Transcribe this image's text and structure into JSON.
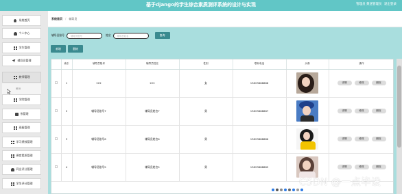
{
  "header": {
    "title": "基于django的学生综合素质测评系统的设计与实现",
    "user_text": "管理员 黄迷管理员",
    "logout": "退出登录",
    "bg_color": "#61c6c6"
  },
  "sidebar": {
    "items": [
      {
        "label": "系统首页",
        "icon": "house-icon"
      },
      {
        "label": "个人中心",
        "icon": "person-icon"
      },
      {
        "label": "学生管理",
        "icon": "grid-icon"
      },
      {
        "label": "辅导员管理",
        "icon": "plane-icon"
      },
      {
        "label": "教师管理",
        "icon": "grid-icon"
      },
      {
        "label": "学院管理",
        "icon": "grid-icon"
      },
      {
        "label": "系管理",
        "icon": "box-icon"
      },
      {
        "label": "班级管理",
        "icon": "grid-icon"
      },
      {
        "label": "学习绩效管理",
        "icon": "grid-icon"
      },
      {
        "label": "德育素质管理",
        "icon": "grid-icon"
      },
      {
        "label": "同业评分管理",
        "icon": "person-icon"
      },
      {
        "label": "学生评分管理",
        "icon": "grid-icon"
      }
    ],
    "submenu": "教师"
  },
  "breadcrumb": {
    "home": "系统首页",
    "current": "辅导员"
  },
  "search": {
    "field1_label": "辅导员账号",
    "field1_placeholder": "辅导员账号",
    "field2_label": "姓名",
    "field2_placeholder": "辅导员姓名",
    "button": "查询"
  },
  "actions": {
    "add": "新增",
    "delete": "删除"
  },
  "table": {
    "headers": [
      "",
      "索引",
      "辅导员账号",
      "辅导员姓名",
      "性别",
      "联系电话",
      "头像",
      "操作"
    ],
    "rows": [
      {
        "index": "1",
        "account": "222",
        "name": "222",
        "gender": "女",
        "phone": "13823888888"
      },
      {
        "index": "2",
        "account": "辅导员账号7",
        "name": "辅导员姓名7",
        "gender": "男",
        "phone": "13823888887"
      },
      {
        "index": "3",
        "account": "辅导员账号6",
        "name": "辅导员姓名6",
        "gender": "男",
        "phone": "13823888886"
      },
      {
        "index": "4",
        "account": "辅导员账号5",
        "name": "辅导员姓名5",
        "gender": "男",
        "phone": "13823888885"
      }
    ],
    "op_labels": {
      "detail": "详情",
      "edit": "修改",
      "delete": "删除"
    }
  },
  "watermark": "CSDN @一点毕设"
}
